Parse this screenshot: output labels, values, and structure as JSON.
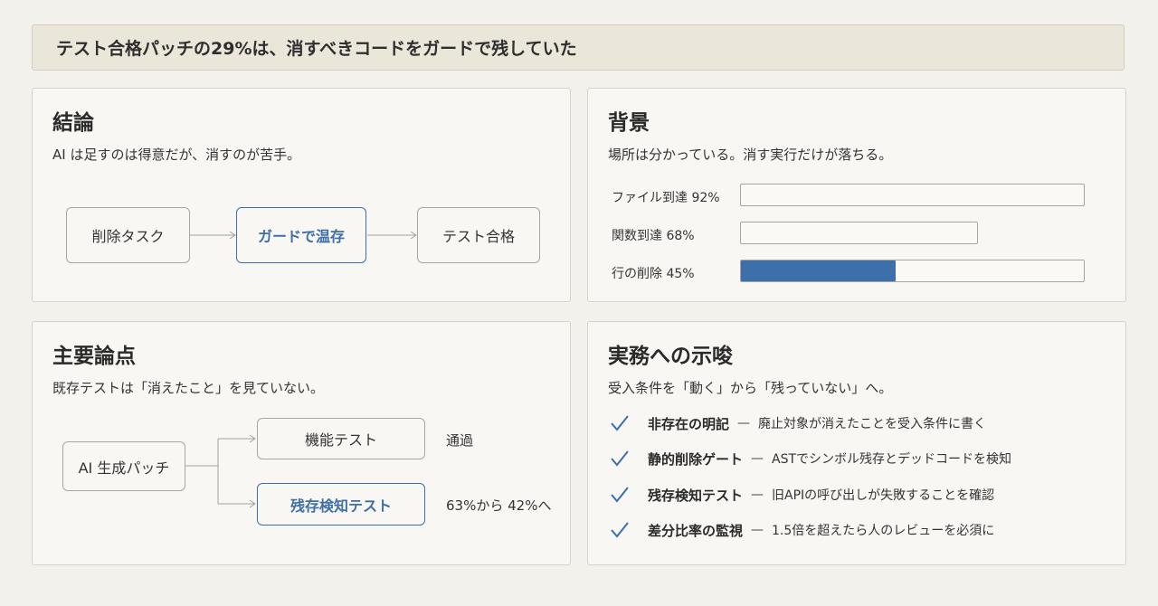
{
  "header": {
    "title": "テスト合格パッチの29%は、消すべきコードをガードで残していた"
  },
  "conclusion": {
    "title": "結論",
    "subtitle": "AI は足すのは得意だが、消すのが苦手。",
    "flow": [
      "削除タスク",
      "ガードで温存",
      "テスト合格"
    ]
  },
  "background": {
    "title": "背景",
    "subtitle": "場所は分かっている。消す実行だけが落ちる。",
    "bars": [
      {
        "label": "ファイル到達 92%",
        "value": 0.92,
        "filled": false
      },
      {
        "label": "関数到達 68%",
        "value": 0.68,
        "filled": false
      },
      {
        "label": "行の削除 45%",
        "value": 0.45,
        "filled": true
      }
    ]
  },
  "key_points": {
    "title": "主要論点",
    "subtitle": "既存テストは「消えたこと」を見ていない。",
    "source": "AI 生成パッチ",
    "branches": [
      {
        "label": "機能テスト",
        "result": "通過"
      },
      {
        "label": "残存検知テスト",
        "result": "63%から 42%へ"
      }
    ]
  },
  "implications": {
    "title": "実務への示唆",
    "subtitle": "受入条件を「動く」から「残っていない」へ。",
    "dash": "—",
    "items": [
      {
        "title": "非存在の明記",
        "desc": "廃止対象が消えたことを受入条件に書く"
      },
      {
        "title": "静的削除ゲート",
        "desc": "ASTでシンボル残存とデッドコードを検知"
      },
      {
        "title": "残存検知テスト",
        "desc": "旧APIの呼び出しが失敗することを確認"
      },
      {
        "title": "差分比率の監視",
        "desc": "1.5倍を超えたら人のレビューを必須に"
      }
    ]
  },
  "colors": {
    "accent": "#3d70ab",
    "background": "#f3f1ec",
    "title_bar": "#ebe6da"
  }
}
